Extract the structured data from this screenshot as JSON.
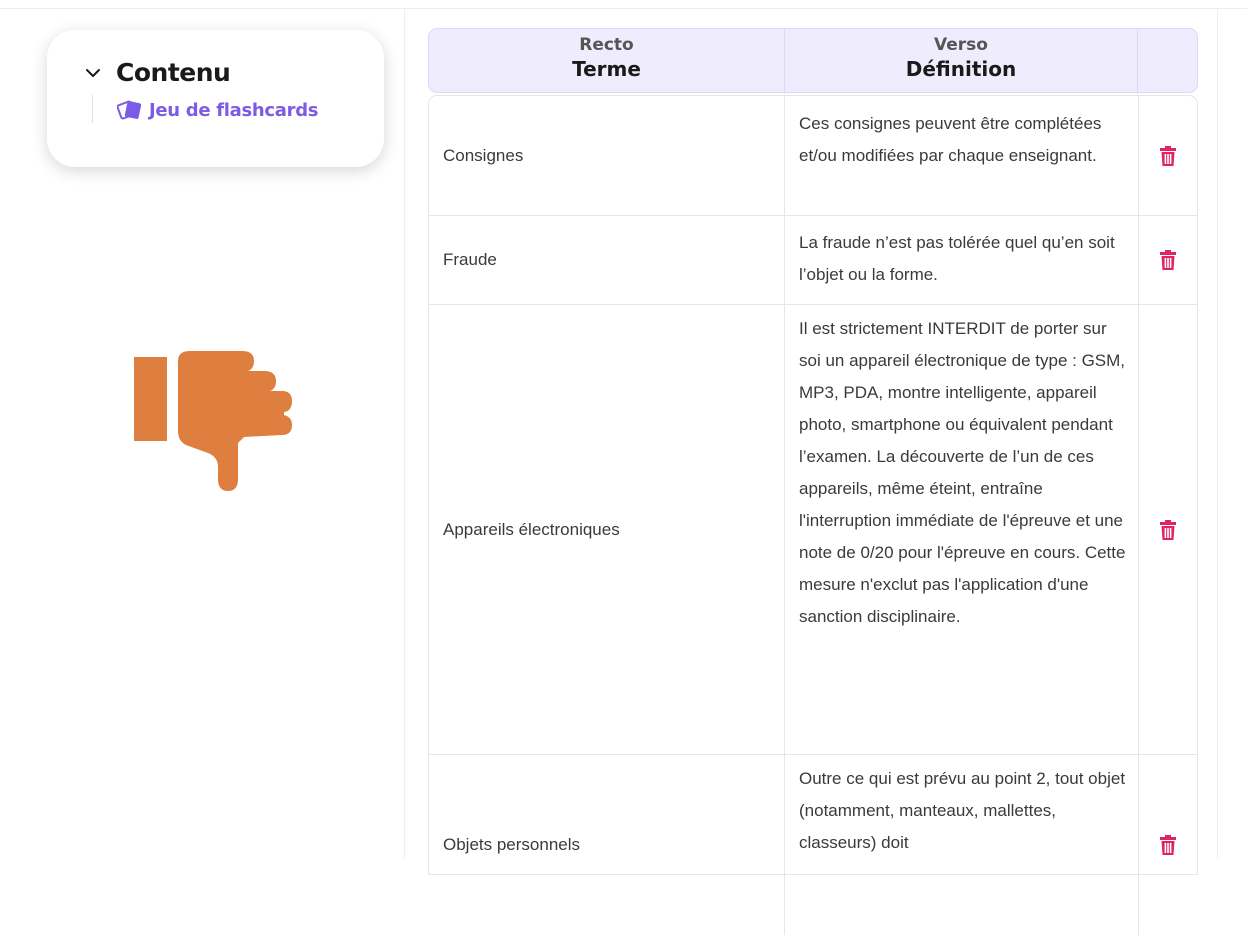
{
  "toc": {
    "title": "Contenu",
    "items": [
      {
        "label": "Jeu de flashcards",
        "icon": "flashcards-icon"
      }
    ],
    "accent_color": "#7c5be6"
  },
  "feedback": {
    "icon": "thumbs-down-icon",
    "color": "#de7f40"
  },
  "table": {
    "header": {
      "col1_sub": "Recto",
      "col1_main": "Terme",
      "col2_sub": "Verso",
      "col2_main": "Définition"
    },
    "rows": [
      {
        "term": "Consignes",
        "definition": "Ces consignes peuvent être complétées et/ou modifiées par chaque enseignant."
      },
      {
        "term": "Fraude",
        "definition": "La fraude n’est pas tolérée quel qu’en soit l’objet ou la forme."
      },
      {
        "term": "Appareils électroniques",
        "definition": "Il est strictement INTERDIT de porter sur soi un appareil électronique de type : GSM, MP3, PDA, montre intelligente, appareil photo, smartphone ou équivalent pendant l’examen. La découverte de l’un de ces appareils, même éteint, entraîne l'interruption immédiate de l'épreuve et une note de 0/20 pour l'épreuve en cours. Cette mesure n'exclut pas l'application d'une sanction disciplinaire."
      },
      {
        "term": "Objets personnels",
        "definition": "Outre ce qui est prévu au point 2, tout objet (notamment, manteaux, mallettes, classeurs) doit"
      }
    ],
    "delete_icon": "trash-icon",
    "delete_color": "#e0245e"
  }
}
